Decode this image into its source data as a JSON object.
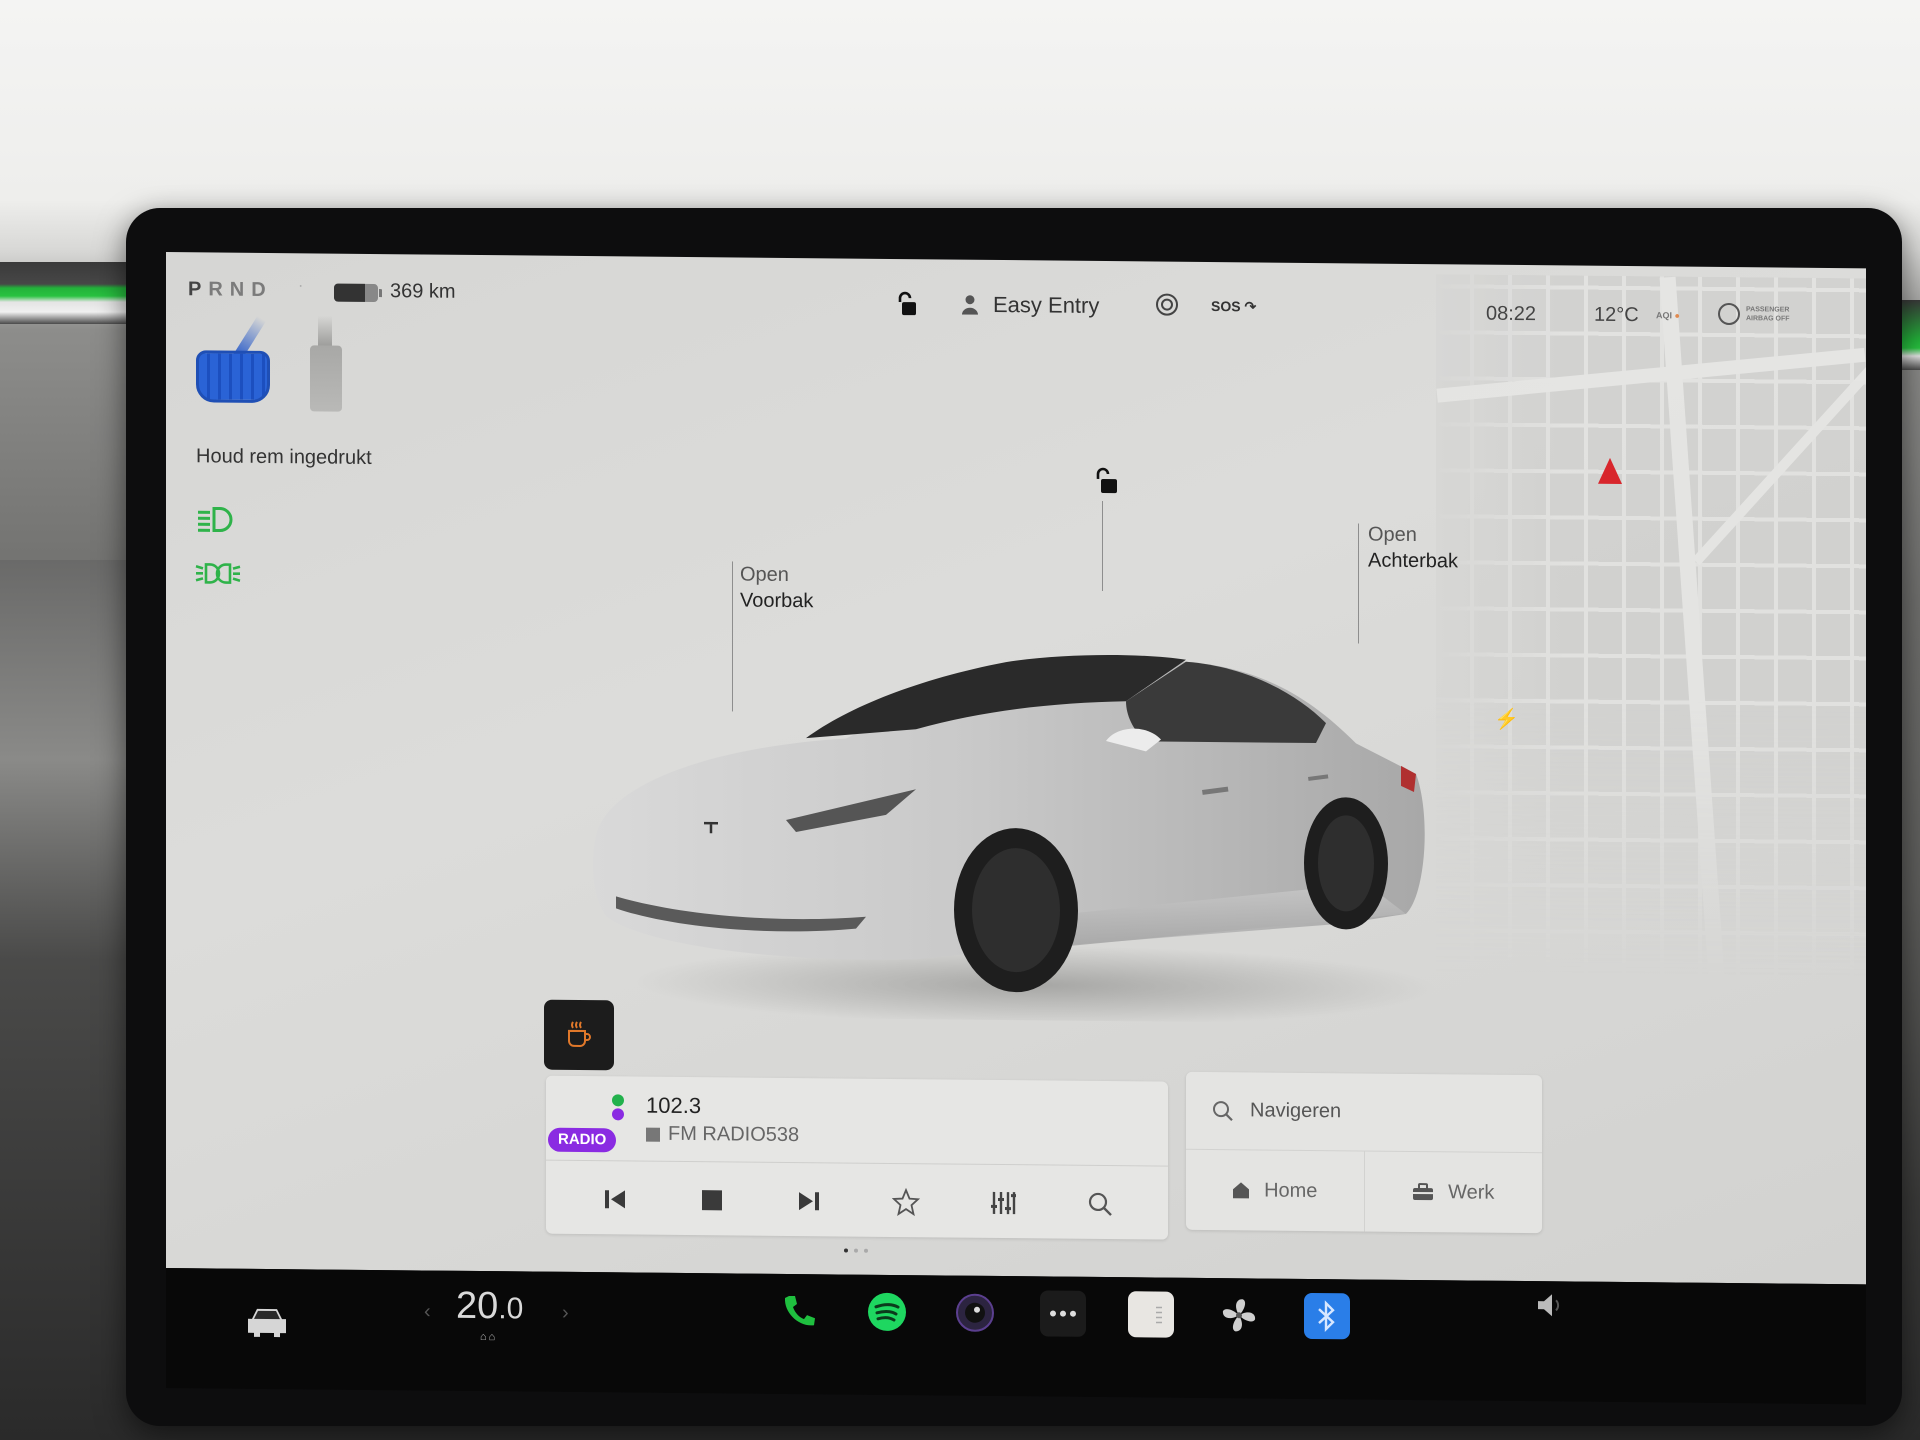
{
  "status_bar": {
    "gears": [
      "P",
      "R",
      "N",
      "D"
    ],
    "active_gear": "P",
    "battery_percent": 70,
    "range": "369 km",
    "profile_name": "Easy Entry",
    "sos_label": "SOS",
    "time": "08:22",
    "temperature": "12°C",
    "aqi_label": "AQI",
    "airbag_label_line1": "PASSENGER",
    "airbag_label_line2": "AIRBAG OFF"
  },
  "pedals": {
    "hint": "Houd rem ingedrukt"
  },
  "indicators": [
    {
      "name": "low-beam-headlights-icon",
      "color": "#2fb34a"
    },
    {
      "name": "parking-lights-icon",
      "color": "#2fb34a"
    }
  ],
  "car_view": {
    "frunk": {
      "action": "Open",
      "label": "Voorbak"
    },
    "trunk": {
      "action": "Open",
      "label": "Achterbak"
    },
    "lock_state": "unlocked",
    "charge_port_icon": "⚡"
  },
  "camp_mode": {
    "icon": "coffee-cup-icon",
    "color": "#e0782a"
  },
  "media": {
    "source_badge": "RADIO",
    "frequency": "102.3",
    "station": "FM RADIO538",
    "controls": [
      {
        "name": "previous-button",
        "glyph": "⏮"
      },
      {
        "name": "stop-button",
        "glyph": "■"
      },
      {
        "name": "next-button",
        "glyph": "⏭"
      },
      {
        "name": "favorite-button",
        "glyph": "☆"
      },
      {
        "name": "equalizer-button",
        "glyph": "⫶"
      },
      {
        "name": "media-search-button",
        "glyph": "⌕"
      }
    ],
    "page": 1,
    "pages": 3
  },
  "navigation": {
    "search_placeholder": "Navigeren",
    "shortcuts": [
      {
        "label": "Home",
        "icon": "home-icon"
      },
      {
        "label": "Werk",
        "icon": "briefcase-icon"
      }
    ]
  },
  "taskbar": {
    "climate_temp_main": "20",
    "climate_temp_decimal": ".0",
    "apps": [
      {
        "name": "phone-app",
        "color": "#1fbf3f"
      },
      {
        "name": "spotify-app",
        "color": "#1ed760"
      },
      {
        "name": "camera-app",
        "color": "#5b3f8f"
      },
      {
        "name": "more-apps",
        "color": "#2a2a2a"
      },
      {
        "name": "notes-app",
        "color": "#e8e6e2"
      },
      {
        "name": "fan-app",
        "color": "#cfcfcf"
      },
      {
        "name": "bluetooth-app",
        "color": "#2a7ee8"
      }
    ]
  }
}
